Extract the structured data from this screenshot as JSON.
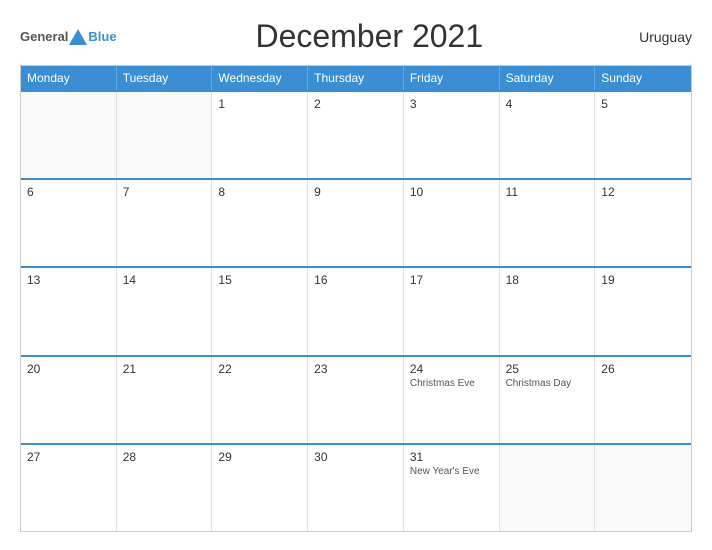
{
  "header": {
    "logo_general": "General",
    "logo_blue": "Blue",
    "title": "December 2021",
    "country": "Uruguay"
  },
  "weekdays": [
    "Monday",
    "Tuesday",
    "Wednesday",
    "Thursday",
    "Friday",
    "Saturday",
    "Sunday"
  ],
  "weeks": [
    [
      {
        "day": "",
        "empty": true
      },
      {
        "day": "",
        "empty": true
      },
      {
        "day": "1",
        "empty": false,
        "event": ""
      },
      {
        "day": "2",
        "empty": false,
        "event": ""
      },
      {
        "day": "3",
        "empty": false,
        "event": ""
      },
      {
        "day": "4",
        "empty": false,
        "event": ""
      },
      {
        "day": "5",
        "empty": false,
        "event": ""
      }
    ],
    [
      {
        "day": "6",
        "empty": false,
        "event": ""
      },
      {
        "day": "7",
        "empty": false,
        "event": ""
      },
      {
        "day": "8",
        "empty": false,
        "event": ""
      },
      {
        "day": "9",
        "empty": false,
        "event": ""
      },
      {
        "day": "10",
        "empty": false,
        "event": ""
      },
      {
        "day": "11",
        "empty": false,
        "event": ""
      },
      {
        "day": "12",
        "empty": false,
        "event": ""
      }
    ],
    [
      {
        "day": "13",
        "empty": false,
        "event": ""
      },
      {
        "day": "14",
        "empty": false,
        "event": ""
      },
      {
        "day": "15",
        "empty": false,
        "event": ""
      },
      {
        "day": "16",
        "empty": false,
        "event": ""
      },
      {
        "day": "17",
        "empty": false,
        "event": ""
      },
      {
        "day": "18",
        "empty": false,
        "event": ""
      },
      {
        "day": "19",
        "empty": false,
        "event": ""
      }
    ],
    [
      {
        "day": "20",
        "empty": false,
        "event": ""
      },
      {
        "day": "21",
        "empty": false,
        "event": ""
      },
      {
        "day": "22",
        "empty": false,
        "event": ""
      },
      {
        "day": "23",
        "empty": false,
        "event": ""
      },
      {
        "day": "24",
        "empty": false,
        "event": "Christmas Eve"
      },
      {
        "day": "25",
        "empty": false,
        "event": "Christmas Day"
      },
      {
        "day": "26",
        "empty": false,
        "event": ""
      }
    ],
    [
      {
        "day": "27",
        "empty": false,
        "event": ""
      },
      {
        "day": "28",
        "empty": false,
        "event": ""
      },
      {
        "day": "29",
        "empty": false,
        "event": ""
      },
      {
        "day": "30",
        "empty": false,
        "event": ""
      },
      {
        "day": "31",
        "empty": false,
        "event": "New Year's Eve"
      },
      {
        "day": "",
        "empty": true
      },
      {
        "day": "",
        "empty": true
      }
    ]
  ]
}
